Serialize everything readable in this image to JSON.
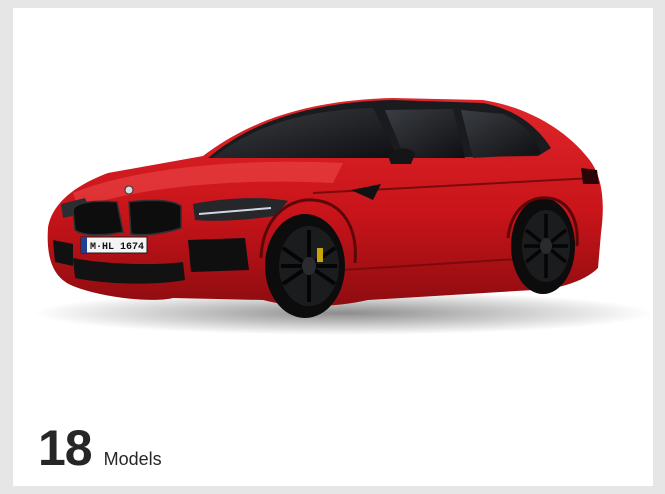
{
  "card": {
    "image": {
      "subject": "car-photo",
      "license_plate": "M·HL 1674",
      "body_color": "#c8141a"
    },
    "count": "18",
    "count_label": "Models"
  }
}
